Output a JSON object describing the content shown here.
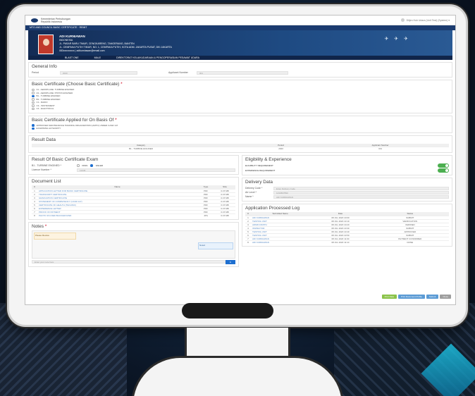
{
  "header": {
    "org_line1": "Kementerian Perhubungan",
    "org_line2": "Republik Indonesia",
    "user_label": "Ditjen Hub Udara (Unit Test) (System) ▾"
  },
  "breadcrumb": "MTO AND COUNCIL BASIC CERTIFICATE · REMIT",
  "profile": {
    "name": "ADI KURNIAWAN",
    "line1": "INDONESIA",
    "line2": "JL. PASAR BARU TIMUR, CENGKARENG, TANGERANG, BANTEN",
    "line3": "JL. CEMPAKA PUTIH TIMUR, NO. 1, CEMPAKA PUTIH, KOTA ADM. JAKARTA PUSAT, DKI JAKARTA",
    "line4": "083xxxxxxxxx  |  adikurniawan@email.com",
    "footer1": "BLAST ONE",
    "footer2": "MALE",
    "footer3": "DIREKTORAT KELAIKUDARAAN & PENGOPERASIAN PESAWAT UDARA"
  },
  "general_info": {
    "title": "General Info",
    "period_label": "Period",
    "period_value": "2020",
    "applicant_label": "Applicant Number",
    "applicant_value": "001"
  },
  "basic_certificate": {
    "title": "Basic Certificate (Choose Basic Certificate)",
    "required": "*",
    "options": [
      {
        "label": "A1 - AEROPLANE: TURBINE ENGINED",
        "selected": false
      },
      {
        "label": "A3 - AEROPLANE: PISTON ENGINED",
        "selected": false
      },
      {
        "label": "B1 - TURBINE ENGINED",
        "selected": true
      },
      {
        "label": "B3 - TURBINE ENGINED",
        "selected": false
      },
      {
        "label": "C1 - RADIO",
        "selected": false
      },
      {
        "label": "C3 - INSTRUMENT",
        "selected": false
      },
      {
        "label": "C4 - ELECTRICAL",
        "selected": false
      }
    ]
  },
  "applied_basis": {
    "title": "Basic Certificate Applied for On Basis Of",
    "required": "*",
    "options": [
      {
        "label": "APPROVED MAINTENANCE TRAINING ORGANIZATION (AMTO) UNDER CASR 147",
        "selected": true
      },
      {
        "label": "EXAMINING AUTHORITY",
        "selected": true
      }
    ]
  },
  "result_data": {
    "title": "Result Data",
    "headers": [
      "Category",
      "Period",
      "Applicant Number"
    ],
    "row": [
      "B1 - TURBINE ENGINED",
      "2020",
      "001"
    ]
  },
  "exam_result": {
    "title": "Result Of Basic Certificate Exam",
    "row1_label": "B1 - TURBINE ENGINED *",
    "opt_pass": "PASS",
    "opt_failed": "FAILED",
    "row2_label": "Licence Number *",
    "row2_value": "12345"
  },
  "eligibility": {
    "title": "Eligibility & Experience",
    "item1": "ELIGIBILITY REQUIREMENT",
    "item2": "EXPERIENCE REQUIREMENT"
  },
  "document_list": {
    "title": "Document List",
    "headers": [
      "#",
      "Name",
      "Type",
      "Size"
    ],
    "rows": [
      [
        "1",
        "APPLICATION LETTER FOR BASIC CERTIFICATE",
        "PDF",
        "0.15 MB"
      ],
      [
        "2",
        "TRANSCRIPT CERTIFICATE",
        "PDF",
        "0.15 MB"
      ],
      [
        "3",
        "GRADUATION CERTIFICATE",
        "PDF",
        "0.15 MB"
      ],
      [
        "4",
        "STATEMENT OF COMPETENCY (CASR 147)",
        "PDF",
        "0.15 MB"
      ],
      [
        "5",
        "CERTIFICATE OF HEALTH (TECHNIC)",
        "PDF",
        "0.15 MB"
      ],
      [
        "6",
        "EXPERIENCE LETTER",
        "PDF",
        "0.15 MB"
      ],
      [
        "7",
        "PROOF OF PAYMENT",
        "PDF",
        "0.15 MB"
      ],
      [
        "8",
        "PHOTO 3X4 RED BACKGROUND",
        "JPG",
        "0.15 MB"
      ]
    ]
  },
  "delivery": {
    "title": "Delivery Data",
    "r1_label": "Delivery Code *",
    "r1_value": "Enter Delivery Code",
    "r2_label": "Air Level *",
    "r2_value": "1234567890",
    "r3_label": "Name *",
    "r3_value": "ADI KURNIAWAN"
  },
  "process_log": {
    "title": "Application Processed Log",
    "headers": [
      "#",
      "Submitted Name",
      "Date",
      "Status"
    ],
    "rows": [
      [
        "1",
        "ADI KURNIAWAN",
        "08 JUL 2020 10:00",
        "SUBMIT"
      ],
      [
        "2",
        "TESTING UNIT",
        "08 JUL 2020 10:10",
        "VERIFICATION"
      ],
      [
        "3",
        "ADMIN DKPPU",
        "08 JUL 2020 10:20",
        "VERIFIED"
      ],
      [
        "4",
        "INSPECTOR",
        "08 JUL 2020 10:30",
        "SUBMIT"
      ],
      [
        "5",
        "TESTING UNIT",
        "08 JUL 2020 10:40",
        "APPROVED"
      ],
      [
        "6",
        "TESTING UNIT",
        "08 JUL 2020 10:50",
        "SUBMIT"
      ],
      [
        "7",
        "ADI KURNIAWAN",
        "08 JUL 2020 11:00",
        "PAYMENT CONFIRMED"
      ],
      [
        "8",
        "ADI KURNIAWAN",
        "08 JUL 2020 11:10",
        "DONE"
      ]
    ]
  },
  "notes": {
    "title": "Notes",
    "required": "*",
    "bubble1": "Please Review",
    "bubble2": "Noted",
    "placeholder": "Enter your note here",
    "send": "➤"
  },
  "actions": {
    "btn1": "Print Data",
    "btn2": "Print Document Profile",
    "btn3": "Submit",
    "btn4": "Close"
  }
}
